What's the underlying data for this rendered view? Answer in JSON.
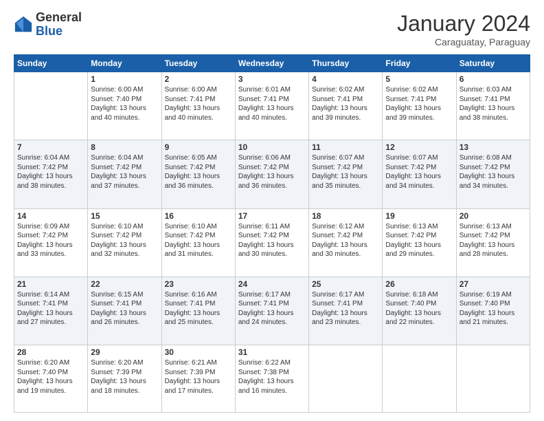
{
  "header": {
    "logo_general": "General",
    "logo_blue": "Blue",
    "month_title": "January 2024",
    "subtitle": "Caraguatay, Paraguay"
  },
  "calendar": {
    "days_of_week": [
      "Sunday",
      "Monday",
      "Tuesday",
      "Wednesday",
      "Thursday",
      "Friday",
      "Saturday"
    ],
    "weeks": [
      [
        {
          "day": "",
          "info": ""
        },
        {
          "day": "1",
          "info": "Sunrise: 6:00 AM\nSunset: 7:40 PM\nDaylight: 13 hours\nand 40 minutes."
        },
        {
          "day": "2",
          "info": "Sunrise: 6:00 AM\nSunset: 7:41 PM\nDaylight: 13 hours\nand 40 minutes."
        },
        {
          "day": "3",
          "info": "Sunrise: 6:01 AM\nSunset: 7:41 PM\nDaylight: 13 hours\nand 40 minutes."
        },
        {
          "day": "4",
          "info": "Sunrise: 6:02 AM\nSunset: 7:41 PM\nDaylight: 13 hours\nand 39 minutes."
        },
        {
          "day": "5",
          "info": "Sunrise: 6:02 AM\nSunset: 7:41 PM\nDaylight: 13 hours\nand 39 minutes."
        },
        {
          "day": "6",
          "info": "Sunrise: 6:03 AM\nSunset: 7:41 PM\nDaylight: 13 hours\nand 38 minutes."
        }
      ],
      [
        {
          "day": "7",
          "info": "Sunrise: 6:04 AM\nSunset: 7:42 PM\nDaylight: 13 hours\nand 38 minutes."
        },
        {
          "day": "8",
          "info": "Sunrise: 6:04 AM\nSunset: 7:42 PM\nDaylight: 13 hours\nand 37 minutes."
        },
        {
          "day": "9",
          "info": "Sunrise: 6:05 AM\nSunset: 7:42 PM\nDaylight: 13 hours\nand 36 minutes."
        },
        {
          "day": "10",
          "info": "Sunrise: 6:06 AM\nSunset: 7:42 PM\nDaylight: 13 hours\nand 36 minutes."
        },
        {
          "day": "11",
          "info": "Sunrise: 6:07 AM\nSunset: 7:42 PM\nDaylight: 13 hours\nand 35 minutes."
        },
        {
          "day": "12",
          "info": "Sunrise: 6:07 AM\nSunset: 7:42 PM\nDaylight: 13 hours\nand 34 minutes."
        },
        {
          "day": "13",
          "info": "Sunrise: 6:08 AM\nSunset: 7:42 PM\nDaylight: 13 hours\nand 34 minutes."
        }
      ],
      [
        {
          "day": "14",
          "info": "Sunrise: 6:09 AM\nSunset: 7:42 PM\nDaylight: 13 hours\nand 33 minutes."
        },
        {
          "day": "15",
          "info": "Sunrise: 6:10 AM\nSunset: 7:42 PM\nDaylight: 13 hours\nand 32 minutes."
        },
        {
          "day": "16",
          "info": "Sunrise: 6:10 AM\nSunset: 7:42 PM\nDaylight: 13 hours\nand 31 minutes."
        },
        {
          "day": "17",
          "info": "Sunrise: 6:11 AM\nSunset: 7:42 PM\nDaylight: 13 hours\nand 30 minutes."
        },
        {
          "day": "18",
          "info": "Sunrise: 6:12 AM\nSunset: 7:42 PM\nDaylight: 13 hours\nand 30 minutes."
        },
        {
          "day": "19",
          "info": "Sunrise: 6:13 AM\nSunset: 7:42 PM\nDaylight: 13 hours\nand 29 minutes."
        },
        {
          "day": "20",
          "info": "Sunrise: 6:13 AM\nSunset: 7:42 PM\nDaylight: 13 hours\nand 28 minutes."
        }
      ],
      [
        {
          "day": "21",
          "info": "Sunrise: 6:14 AM\nSunset: 7:41 PM\nDaylight: 13 hours\nand 27 minutes."
        },
        {
          "day": "22",
          "info": "Sunrise: 6:15 AM\nSunset: 7:41 PM\nDaylight: 13 hours\nand 26 minutes."
        },
        {
          "day": "23",
          "info": "Sunrise: 6:16 AM\nSunset: 7:41 PM\nDaylight: 13 hours\nand 25 minutes."
        },
        {
          "day": "24",
          "info": "Sunrise: 6:17 AM\nSunset: 7:41 PM\nDaylight: 13 hours\nand 24 minutes."
        },
        {
          "day": "25",
          "info": "Sunrise: 6:17 AM\nSunset: 7:41 PM\nDaylight: 13 hours\nand 23 minutes."
        },
        {
          "day": "26",
          "info": "Sunrise: 6:18 AM\nSunset: 7:40 PM\nDaylight: 13 hours\nand 22 minutes."
        },
        {
          "day": "27",
          "info": "Sunrise: 6:19 AM\nSunset: 7:40 PM\nDaylight: 13 hours\nand 21 minutes."
        }
      ],
      [
        {
          "day": "28",
          "info": "Sunrise: 6:20 AM\nSunset: 7:40 PM\nDaylight: 13 hours\nand 19 minutes."
        },
        {
          "day": "29",
          "info": "Sunrise: 6:20 AM\nSunset: 7:39 PM\nDaylight: 13 hours\nand 18 minutes."
        },
        {
          "day": "30",
          "info": "Sunrise: 6:21 AM\nSunset: 7:39 PM\nDaylight: 13 hours\nand 17 minutes."
        },
        {
          "day": "31",
          "info": "Sunrise: 6:22 AM\nSunset: 7:38 PM\nDaylight: 13 hours\nand 16 minutes."
        },
        {
          "day": "",
          "info": ""
        },
        {
          "day": "",
          "info": ""
        },
        {
          "day": "",
          "info": ""
        }
      ]
    ]
  }
}
